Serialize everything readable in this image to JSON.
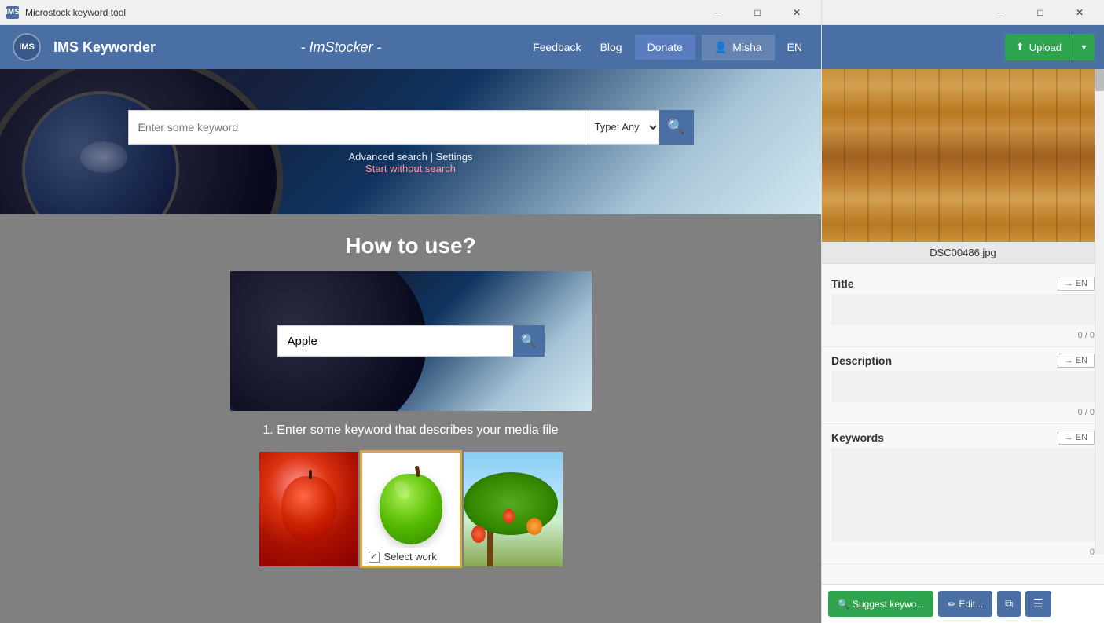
{
  "titleBar": {
    "icon": "IMS",
    "title": "Microstock keyword tool",
    "minimizeLabel": "─",
    "maximizeLabel": "□",
    "closeLabel": "✕"
  },
  "navbar": {
    "logo": "IMS",
    "brand": "IMS Keyworder",
    "center": "- ImStocker -",
    "feedback": "Feedback",
    "blog": "Blog",
    "donate": "Donate",
    "user": "Misha",
    "lang": "EN"
  },
  "hero": {
    "searchPlaceholder": "Enter some keyword",
    "typeLabel": "Type: Any",
    "advancedSearch": "Advanced search",
    "separator": "|",
    "settings": "Settings",
    "startWithout": "Start without search"
  },
  "main": {
    "howToTitle": "How to use?",
    "demoKeyword": "Apple",
    "stepText": "1. Enter some keyword that describes your media file",
    "selectWorkLabel": "Select work"
  },
  "rightPanel": {
    "uploadBtn": "⬆ Upload",
    "filename": "DSC00486.jpg",
    "titleLabel": "Title",
    "titleEnBtn": "→ EN",
    "titleCounter": "0 / 0",
    "descLabel": "Description",
    "descEnBtn": "→ EN",
    "descCounter": "0 / 0",
    "keywordsLabel": "Keywords",
    "keywordsEnBtn": "→ EN",
    "keywordsCounter": "0",
    "suggestBtn": "🔍 Suggest keywo...",
    "editBtn": "✏ Edit...",
    "copyIcon": "⧉",
    "menuIcon": "☰"
  },
  "colors": {
    "navBg": "#4a6fa5",
    "donateBg": "#5a7dbf",
    "searchBtn": "#4a6fa5",
    "uploadGreen": "#2ea44f",
    "selectedBorder": "#d4a843"
  }
}
